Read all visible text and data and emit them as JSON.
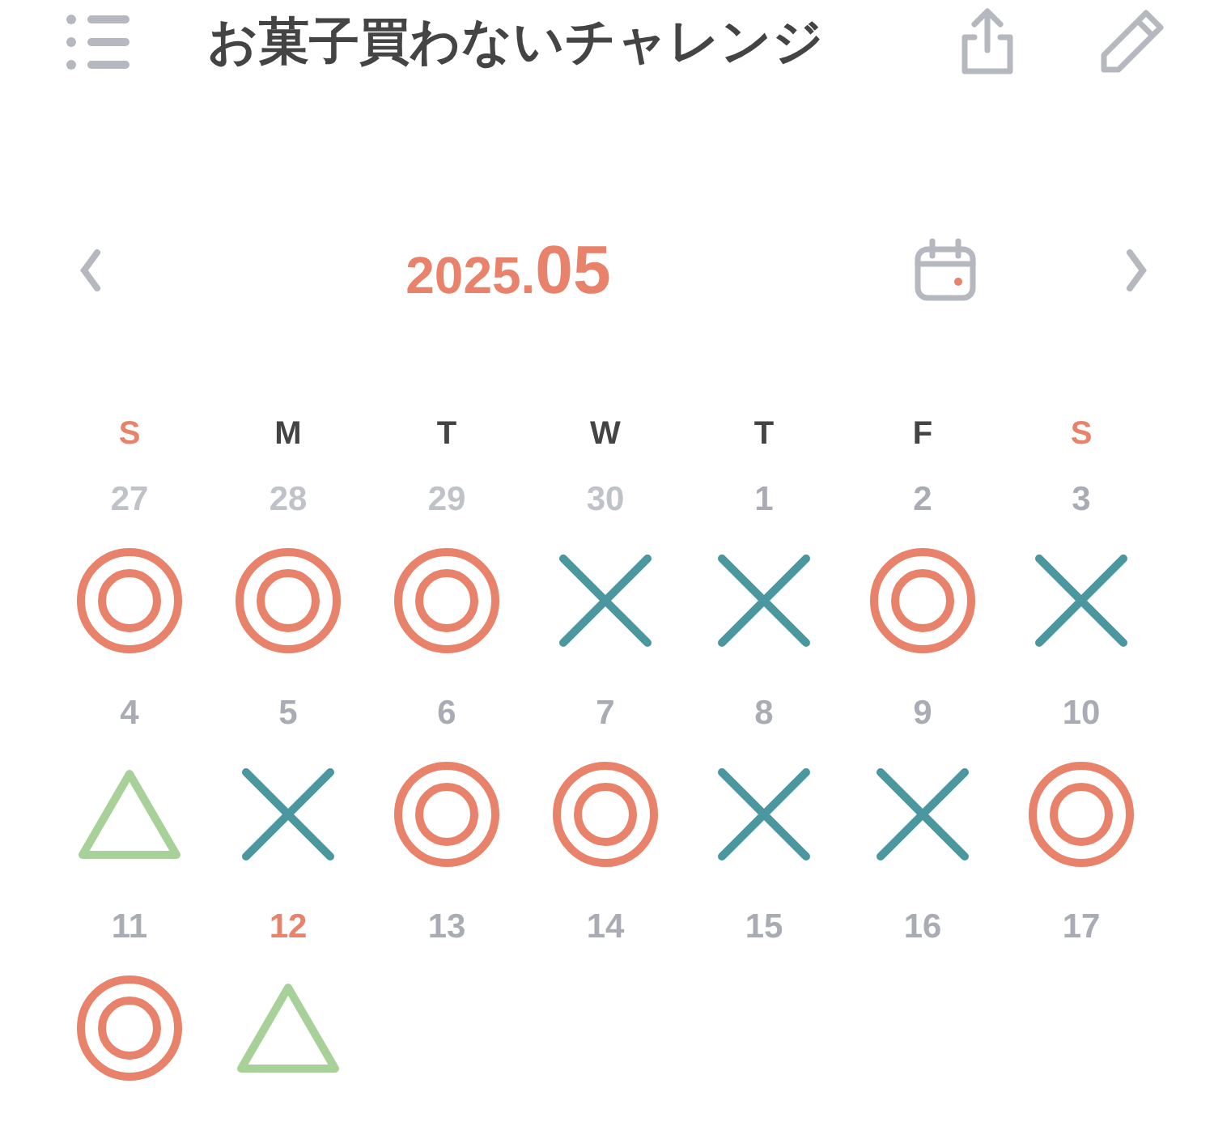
{
  "title": "お菓子買わないチャレンジ",
  "month": {
    "year": "2025.",
    "month": "05"
  },
  "weekdays": [
    {
      "label": "S",
      "color": "#e8826a"
    },
    {
      "label": "M",
      "color": "#444444"
    },
    {
      "label": "T",
      "color": "#444444"
    },
    {
      "label": "W",
      "color": "#444444"
    },
    {
      "label": "T",
      "color": "#444444"
    },
    {
      "label": "F",
      "color": "#444444"
    },
    {
      "label": "S",
      "color": "#e8826a"
    }
  ],
  "days": [
    {
      "day": "27",
      "outside": true,
      "today": false,
      "kind": "double-circle"
    },
    {
      "day": "28",
      "outside": true,
      "today": false,
      "kind": "double-circle"
    },
    {
      "day": "29",
      "outside": true,
      "today": false,
      "kind": "double-circle"
    },
    {
      "day": "30",
      "outside": true,
      "today": false,
      "kind": "cross"
    },
    {
      "day": "1",
      "outside": false,
      "today": false,
      "kind": "cross"
    },
    {
      "day": "2",
      "outside": false,
      "today": false,
      "kind": "double-circle"
    },
    {
      "day": "3",
      "outside": false,
      "today": false,
      "kind": "cross"
    },
    {
      "day": "4",
      "outside": false,
      "today": false,
      "kind": "triangle"
    },
    {
      "day": "5",
      "outside": false,
      "today": false,
      "kind": "cross"
    },
    {
      "day": "6",
      "outside": false,
      "today": false,
      "kind": "double-circle"
    },
    {
      "day": "7",
      "outside": false,
      "today": false,
      "kind": "double-circle"
    },
    {
      "day": "8",
      "outside": false,
      "today": false,
      "kind": "cross"
    },
    {
      "day": "9",
      "outside": false,
      "today": false,
      "kind": "cross"
    },
    {
      "day": "10",
      "outside": false,
      "today": false,
      "kind": "double-circle"
    },
    {
      "day": "11",
      "outside": false,
      "today": false,
      "kind": "double-circle"
    },
    {
      "day": "12",
      "outside": false,
      "today": true,
      "kind": "triangle"
    },
    {
      "day": "13",
      "outside": false,
      "today": false
    },
    {
      "day": "14",
      "outside": false,
      "today": false
    },
    {
      "day": "15",
      "outside": false,
      "today": false
    },
    {
      "day": "16",
      "outside": false,
      "today": false
    },
    {
      "day": "17",
      "outside": false,
      "today": false
    }
  ]
}
